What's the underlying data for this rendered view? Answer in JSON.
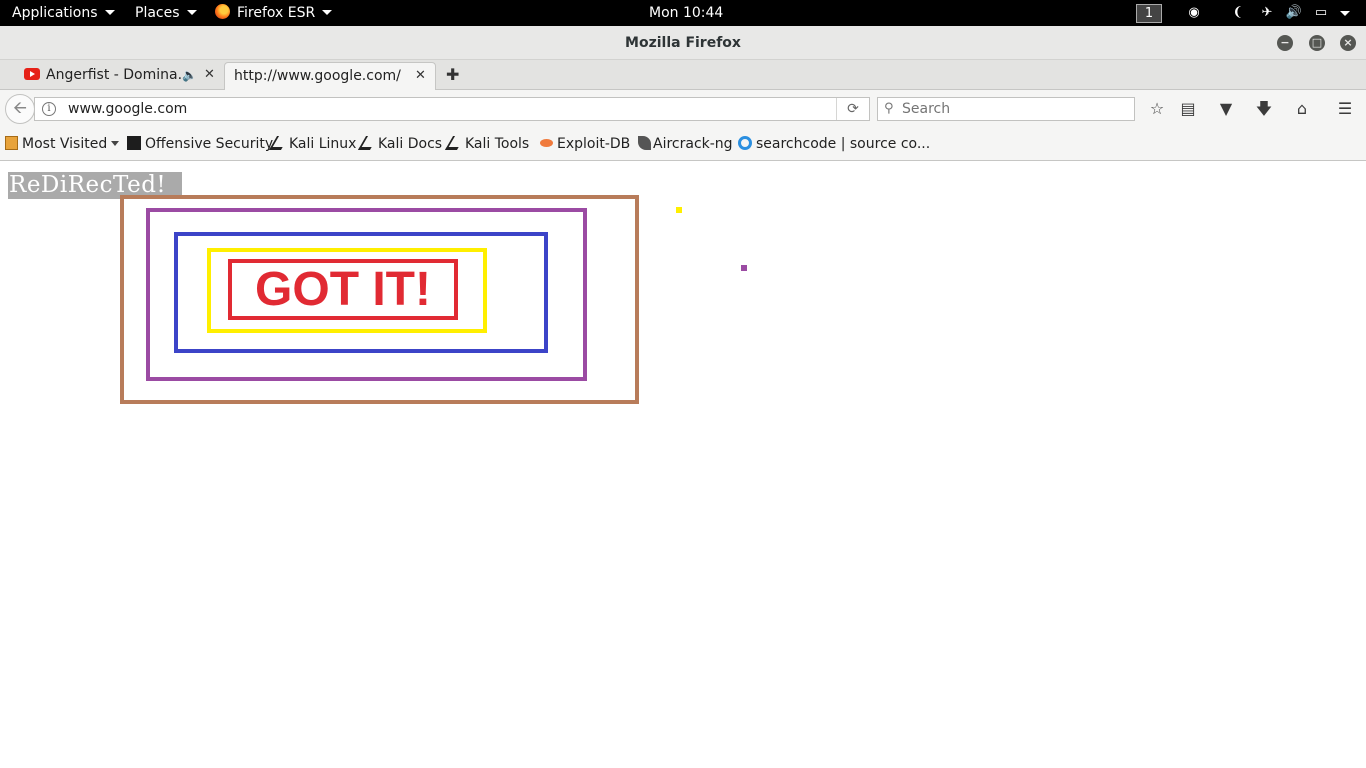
{
  "topbar": {
    "applications_label": "Applications",
    "places_label": "Places",
    "firefox_label": "Firefox ESR",
    "clock": "Mon 10:44",
    "workspace": "1"
  },
  "window": {
    "title": "Mozilla Firefox"
  },
  "tabs": [
    {
      "title": "Angerfist - Domina...",
      "icon": "youtube-icon",
      "audio": true
    },
    {
      "title": "http://www.google.com/",
      "active": true
    }
  ],
  "navbar": {
    "url": "www.google.com",
    "search_placeholder": "Search"
  },
  "bookmarks": [
    {
      "label": "Most Visited",
      "icon": "most-visited-icon"
    },
    {
      "label": "Offensive Security",
      "icon": "offensive-security-icon"
    },
    {
      "label": "Kali Linux",
      "icon": "kali-dragon-icon"
    },
    {
      "label": "Kali Docs",
      "icon": "kali-dragon-icon"
    },
    {
      "label": "Kali Tools",
      "icon": "kali-dragon-icon"
    },
    {
      "label": "Exploit-DB",
      "icon": "exploit-db-icon"
    },
    {
      "label": "Aircrack-ng",
      "icon": "aircrack-icon"
    },
    {
      "label": "searchcode | source co...",
      "icon": "searchcode-icon"
    }
  ],
  "page": {
    "redirected_text": "ReDiRecTed!",
    "got_it_text": "GOT IT!",
    "colors": {
      "gray_banner": "#aaaaaa",
      "brown": "#b87c5a",
      "purple": "#9b4ba3",
      "blue": "#3c44c8",
      "yellow": "#ffef00",
      "red": "#e12a33"
    }
  }
}
